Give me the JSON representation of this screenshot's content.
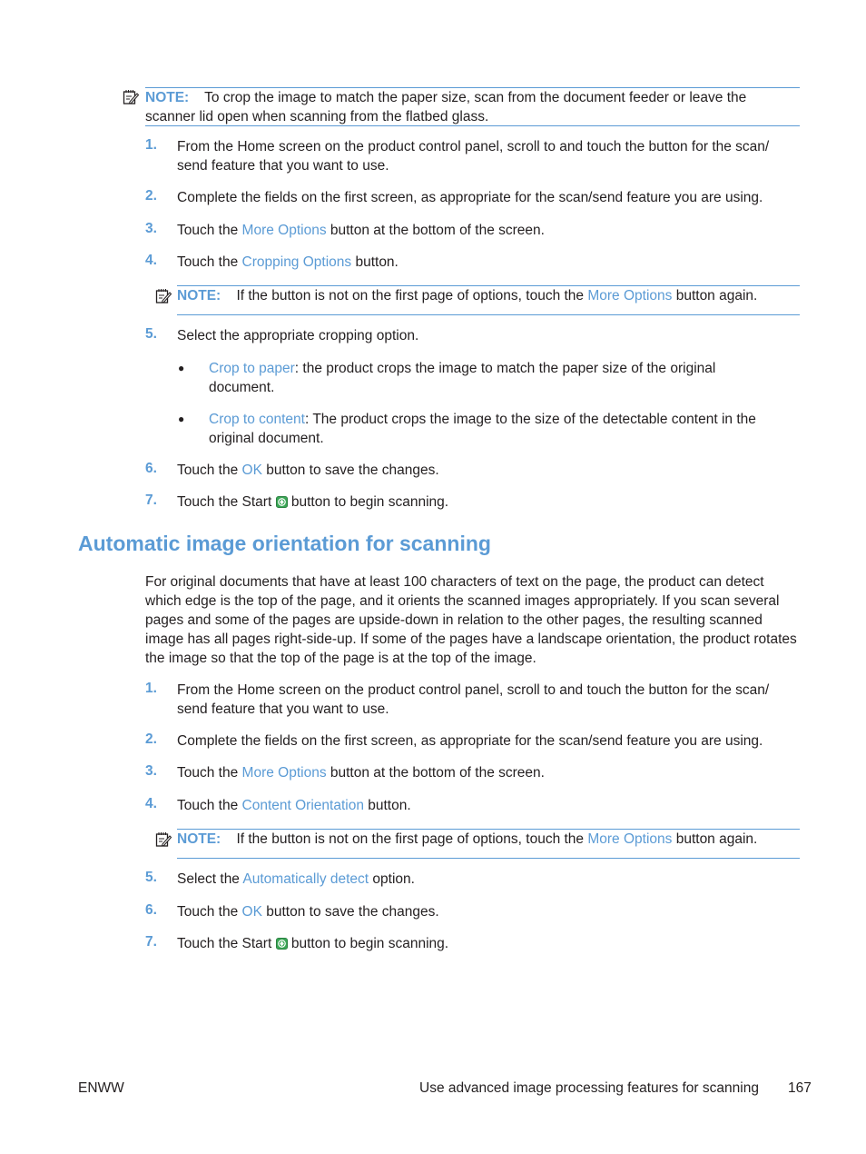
{
  "note1": {
    "label": "NOTE:",
    "text": "To crop the image to match the paper size, scan from the document feeder or leave the scanner lid open when scanning from the flatbed glass."
  },
  "section1": {
    "steps": [
      {
        "num": "1.",
        "text": "From the Home screen on the product control panel, scroll to and touch the button for the scan/ send feature that you want to use."
      },
      {
        "num": "2.",
        "text": "Complete the fields on the first screen, as appropriate for the scan/send feature you are using."
      },
      {
        "num": "3.",
        "pre": "Touch the ",
        "link": "More Options",
        "post": " button at the bottom of the screen."
      },
      {
        "num": "4.",
        "pre": "Touch the ",
        "link": "Cropping Options",
        "post": " button."
      },
      {
        "num": "5.",
        "text": "Select the appropriate cropping option."
      },
      {
        "num": "6.",
        "pre": "Touch the ",
        "link": "OK",
        "post": " button to save the changes."
      },
      {
        "num": "7.",
        "pre": "Touch the Start ",
        "post": " button to begin scanning."
      }
    ],
    "note": {
      "label": "NOTE:",
      "pre": "If the button is not on the first page of options, touch the ",
      "link": "More Options",
      "post": " button again."
    },
    "bullets": [
      {
        "link": "Crop to paper",
        "text": ": the product crops the image to match the paper size of the original document."
      },
      {
        "link": "Crop to content",
        "text": ": The product crops the image to the size of the detectable content in the original document."
      }
    ]
  },
  "section2": {
    "heading": "Automatic image orientation for scanning",
    "paragraph": "For original documents that have at least 100 characters of text on the page, the product can detect which edge is the top of the page, and it orients the scanned images appropriately. If you scan several pages and some of the pages are upside-down in relation to the other pages, the resulting scanned image has all pages right-side-up. If some of the pages have a landscape orientation, the product rotates the image so that the top of the page is at the top of the image.",
    "steps": [
      {
        "num": "1.",
        "text": "From the Home screen on the product control panel, scroll to and touch the button for the scan/ send feature that you want to use."
      },
      {
        "num": "2.",
        "text": "Complete the fields on the first screen, as appropriate for the scan/send feature you are using."
      },
      {
        "num": "3.",
        "pre": "Touch the ",
        "link": "More Options",
        "post": " button at the bottom of the screen."
      },
      {
        "num": "4.",
        "pre": "Touch the ",
        "link": "Content Orientation",
        "post": " button."
      },
      {
        "num": "5.",
        "pre": "Select the ",
        "link": "Automatically detect",
        "post": " option."
      },
      {
        "num": "6.",
        "pre": "Touch the ",
        "link": "OK",
        "post": " button to save the changes."
      },
      {
        "num": "7.",
        "pre": "Touch the Start ",
        "post": " button to begin scanning."
      }
    ],
    "note": {
      "label": "NOTE:",
      "pre": "If the button is not on the first page of options, touch the ",
      "link": "More Options",
      "post": " button again."
    }
  },
  "footer": {
    "left": "ENWW",
    "section": "Use advanced image processing features for scanning",
    "page": "167"
  }
}
